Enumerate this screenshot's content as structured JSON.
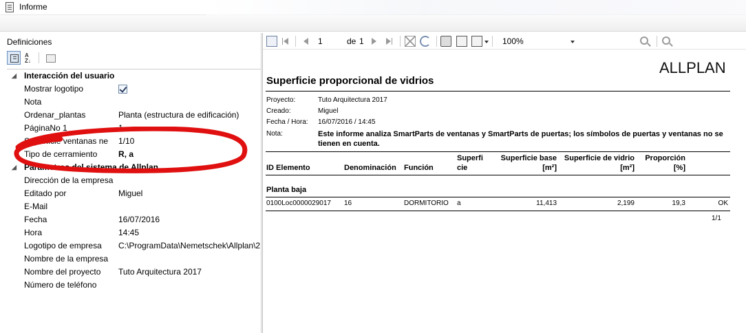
{
  "window": {
    "title": "Informe",
    "icon": "report-icon"
  },
  "left": {
    "header": "Definiciones",
    "toolbar": [
      "categorized-icon",
      "alphabetical-sort-icon",
      "property-pages-icon"
    ],
    "rows": [
      {
        "type": "category",
        "label": "Interacción del usuario"
      },
      {
        "label": "Mostrar logotipo",
        "checkbox": true
      },
      {
        "label": "Nota",
        "value": ""
      },
      {
        "label": "Ordenar_plantas",
        "value": "Planta (estructura de edificación)"
      },
      {
        "label": "PáginaNo 1",
        "value": "1"
      },
      {
        "label": "Superficie ventanas ne",
        "value": "1/10"
      },
      {
        "label": "Tipo de cerramiento",
        "value": "R, a",
        "bold": true
      },
      {
        "type": "category",
        "label": "Parámetros del sistema de Allplan"
      },
      {
        "label": "Dirección de la empresa",
        "value": ""
      },
      {
        "label": "Editado por",
        "value": "Miguel"
      },
      {
        "label": "E-Mail",
        "value": ""
      },
      {
        "label": "Fecha",
        "value": "16/07/2016"
      },
      {
        "label": "Hora",
        "value": "14:45"
      },
      {
        "label": "Logotipo de empresa",
        "value": "C:\\ProgramData\\Nemetschek\\Allplan\\2"
      },
      {
        "label": "Nombre de la empresa",
        "value": ""
      },
      {
        "label": "Nombre del proyecto",
        "value": "Tuto Arquitectura 2017"
      },
      {
        "label": "Número de teléfono",
        "value": ""
      }
    ],
    "annotation_color": "#e01010"
  },
  "viewer": {
    "page": "1",
    "of_label": "de",
    "total_pages": "1",
    "zoom": "100%"
  },
  "report": {
    "logo": "ALLPLAN",
    "title": "Superficie proporcional de vidrios",
    "meta": [
      {
        "label": "Proyecto:",
        "value": "Tuto Arquitectura 2017"
      },
      {
        "label": "Creado:",
        "value": "Miguel"
      },
      {
        "label": "Fecha / Hora:",
        "value": "16/07/2016  /  14:45"
      }
    ],
    "nota_label": "Nota:",
    "nota": "Este informe analiza SmartParts de ventanas y SmartParts de puertas; los símbolos de puertas y ventanas no se tienen en cuenta.",
    "columns": {
      "id": "ID Elemento",
      "denom": "Denominación",
      "funcion": "Función",
      "superficie_1": "Superfi",
      "superficie_2": "cie",
      "base_1": "Superficie base",
      "base_2": "[m²]",
      "vidrio_1": "Superficie de vidrio",
      "vidrio_2": "[m²]",
      "prop_1": "Proporción",
      "prop_2": "[%]"
    },
    "group": "Planta baja",
    "rows": [
      {
        "id": "0100Loc0000029017",
        "denom": "16",
        "funcion": "DORMITORIO",
        "superficie": "a",
        "base": "11,413",
        "vidrio": "2,199",
        "prop": "19,3",
        "status": "OK"
      }
    ],
    "page_indicator": "1/1"
  }
}
